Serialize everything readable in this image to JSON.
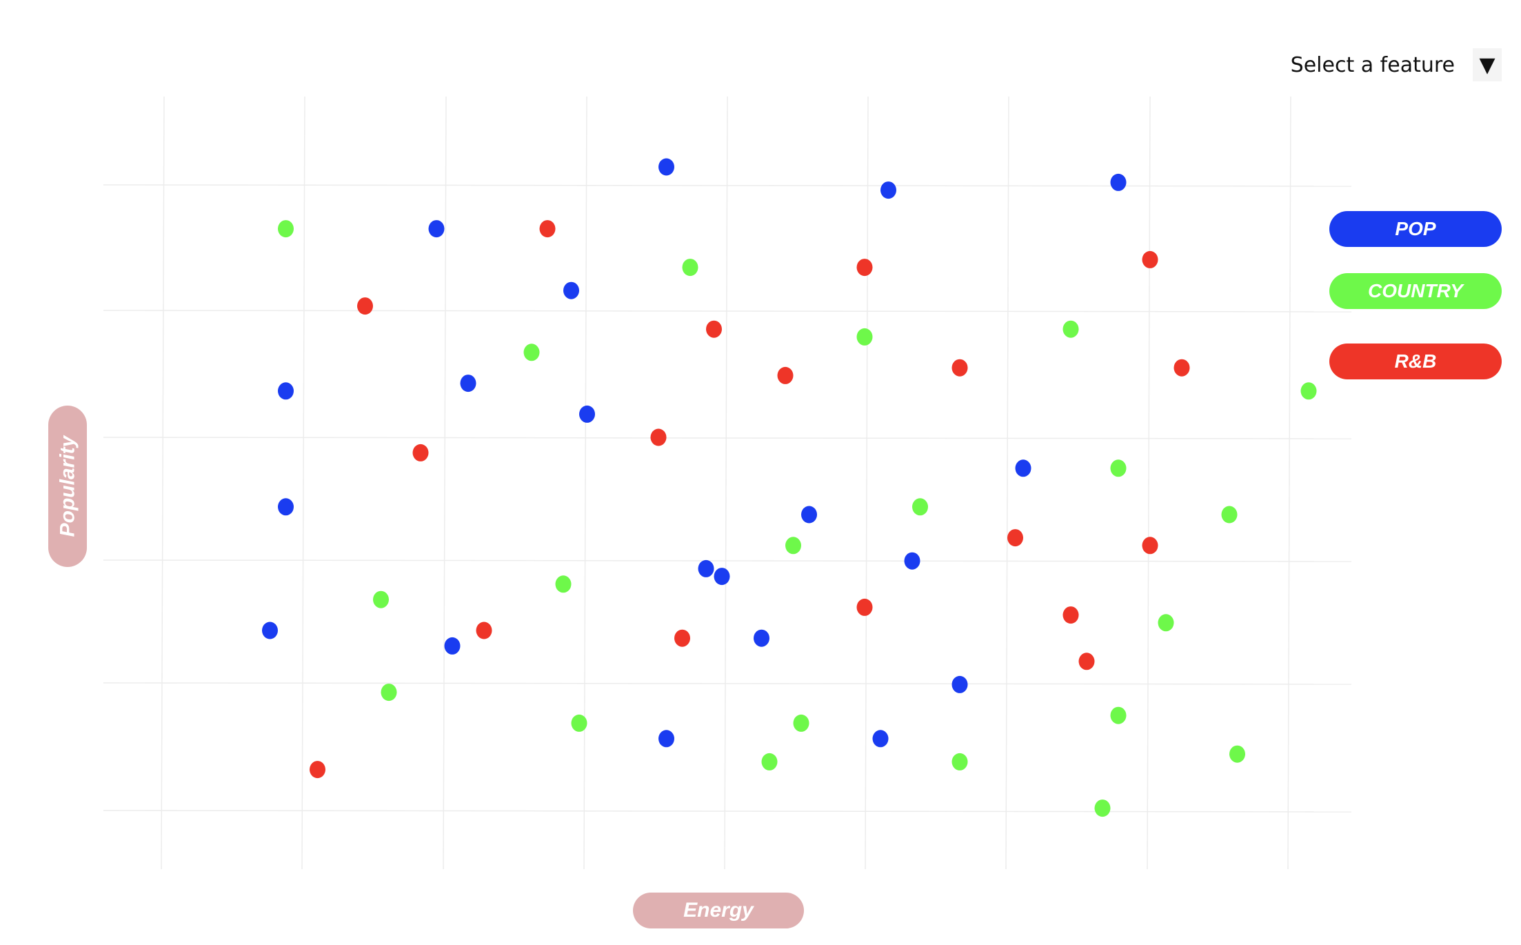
{
  "feature_select": {
    "label": "Select a feature",
    "arrow": "▼"
  },
  "axes": {
    "x_label": "Energy",
    "y_label": "Popularity"
  },
  "legend": [
    {
      "name": "POP",
      "color": "#1a3cf0"
    },
    {
      "name": "COUNTRY",
      "color": "#6ef84a"
    },
    {
      "name": "R&B",
      "color": "#ee3528"
    }
  ],
  "colors": {
    "pop": "#1a3cf0",
    "country": "#6ef84a",
    "rnb": "#ee3528",
    "axis_pill": "#dfb0b1"
  },
  "chart_data": {
    "type": "scatter",
    "title": "",
    "xlabel": "Energy",
    "ylabel": "Popularity",
    "grid": true,
    "legend_position": "right",
    "series": [
      {
        "name": "POP",
        "color": "#1a3cf0",
        "points": [
          [
            0.71,
            0.9
          ],
          [
            0.99,
            0.87
          ],
          [
            1.28,
            0.88
          ],
          [
            0.42,
            0.82
          ],
          [
            0.59,
            0.74
          ],
          [
            0.23,
            0.61
          ],
          [
            0.46,
            0.62
          ],
          [
            0.61,
            0.58
          ],
          [
            1.16,
            0.51
          ],
          [
            0.89,
            0.45
          ],
          [
            0.23,
            0.46
          ],
          [
            0.76,
            0.38
          ],
          [
            1.02,
            0.39
          ],
          [
            0.44,
            0.28
          ],
          [
            0.78,
            0.37
          ],
          [
            0.21,
            0.3
          ],
          [
            0.83,
            0.29
          ],
          [
            1.08,
            0.23
          ],
          [
            0.71,
            0.16
          ],
          [
            0.98,
            0.16
          ]
        ]
      },
      {
        "name": "COUNTRY",
        "color": "#6ef84a",
        "points": [
          [
            0.23,
            0.82
          ],
          [
            0.74,
            0.77
          ],
          [
            0.96,
            0.68
          ],
          [
            1.22,
            0.69
          ],
          [
            0.54,
            0.66
          ],
          [
            1.52,
            0.61
          ],
          [
            1.28,
            0.51
          ],
          [
            1.03,
            0.46
          ],
          [
            1.42,
            0.45
          ],
          [
            0.87,
            0.41
          ],
          [
            0.58,
            0.36
          ],
          [
            0.35,
            0.34
          ],
          [
            1.34,
            0.31
          ],
          [
            0.36,
            0.22
          ],
          [
            1.28,
            0.19
          ],
          [
            0.6,
            0.18
          ],
          [
            0.88,
            0.18
          ],
          [
            1.43,
            0.14
          ],
          [
            0.84,
            0.13
          ],
          [
            1.08,
            0.13
          ],
          [
            1.26,
            0.07
          ]
        ]
      },
      {
        "name": "R&B",
        "color": "#ee3528",
        "points": [
          [
            0.56,
            0.82
          ],
          [
            0.96,
            0.77
          ],
          [
            1.32,
            0.78
          ],
          [
            0.33,
            0.72
          ],
          [
            0.77,
            0.69
          ],
          [
            1.36,
            0.64
          ],
          [
            0.86,
            0.63
          ],
          [
            1.08,
            0.64
          ],
          [
            0.7,
            0.55
          ],
          [
            0.4,
            0.53
          ],
          [
            1.15,
            0.42
          ],
          [
            1.32,
            0.41
          ],
          [
            0.96,
            0.33
          ],
          [
            1.22,
            0.32
          ],
          [
            0.48,
            0.3
          ],
          [
            0.73,
            0.29
          ],
          [
            1.24,
            0.26
          ],
          [
            0.27,
            0.12
          ]
        ]
      }
    ]
  }
}
